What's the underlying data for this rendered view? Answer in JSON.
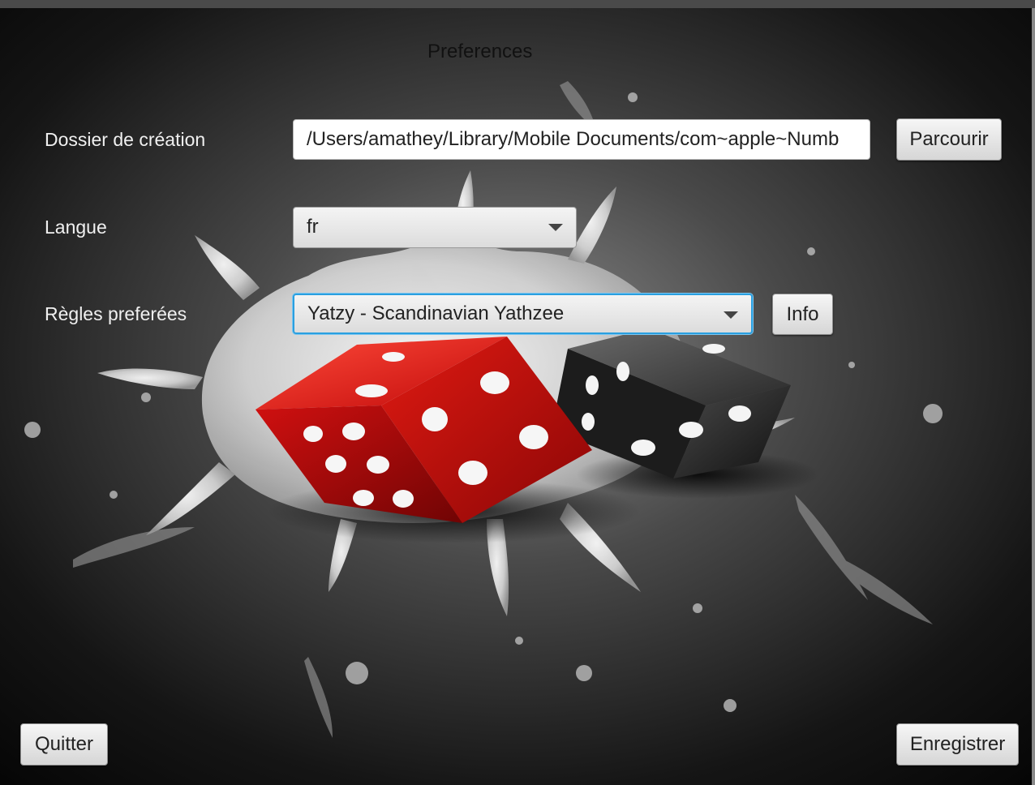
{
  "window": {
    "title": "Preferences"
  },
  "form": {
    "folder": {
      "label": "Dossier de création",
      "value": "/Users/amathey/Library/Mobile Documents/com~apple~Numb",
      "browse_label": "Parcourir"
    },
    "language": {
      "label": "Langue",
      "selected": "fr"
    },
    "rules": {
      "label": "Règles preferées",
      "selected": "Yatzy - Scandinavian Yathzee",
      "info_label": "Info"
    }
  },
  "footer": {
    "quit_label": "Quitter",
    "save_label": "Enregistrer"
  },
  "colors": {
    "focus_ring": "#2a9fe0",
    "label_text": "#f0f0f0",
    "red_die": "#c01010",
    "black_die": "#2a2a2a"
  },
  "icons": {
    "dropdown": "chevron-down-icon"
  }
}
